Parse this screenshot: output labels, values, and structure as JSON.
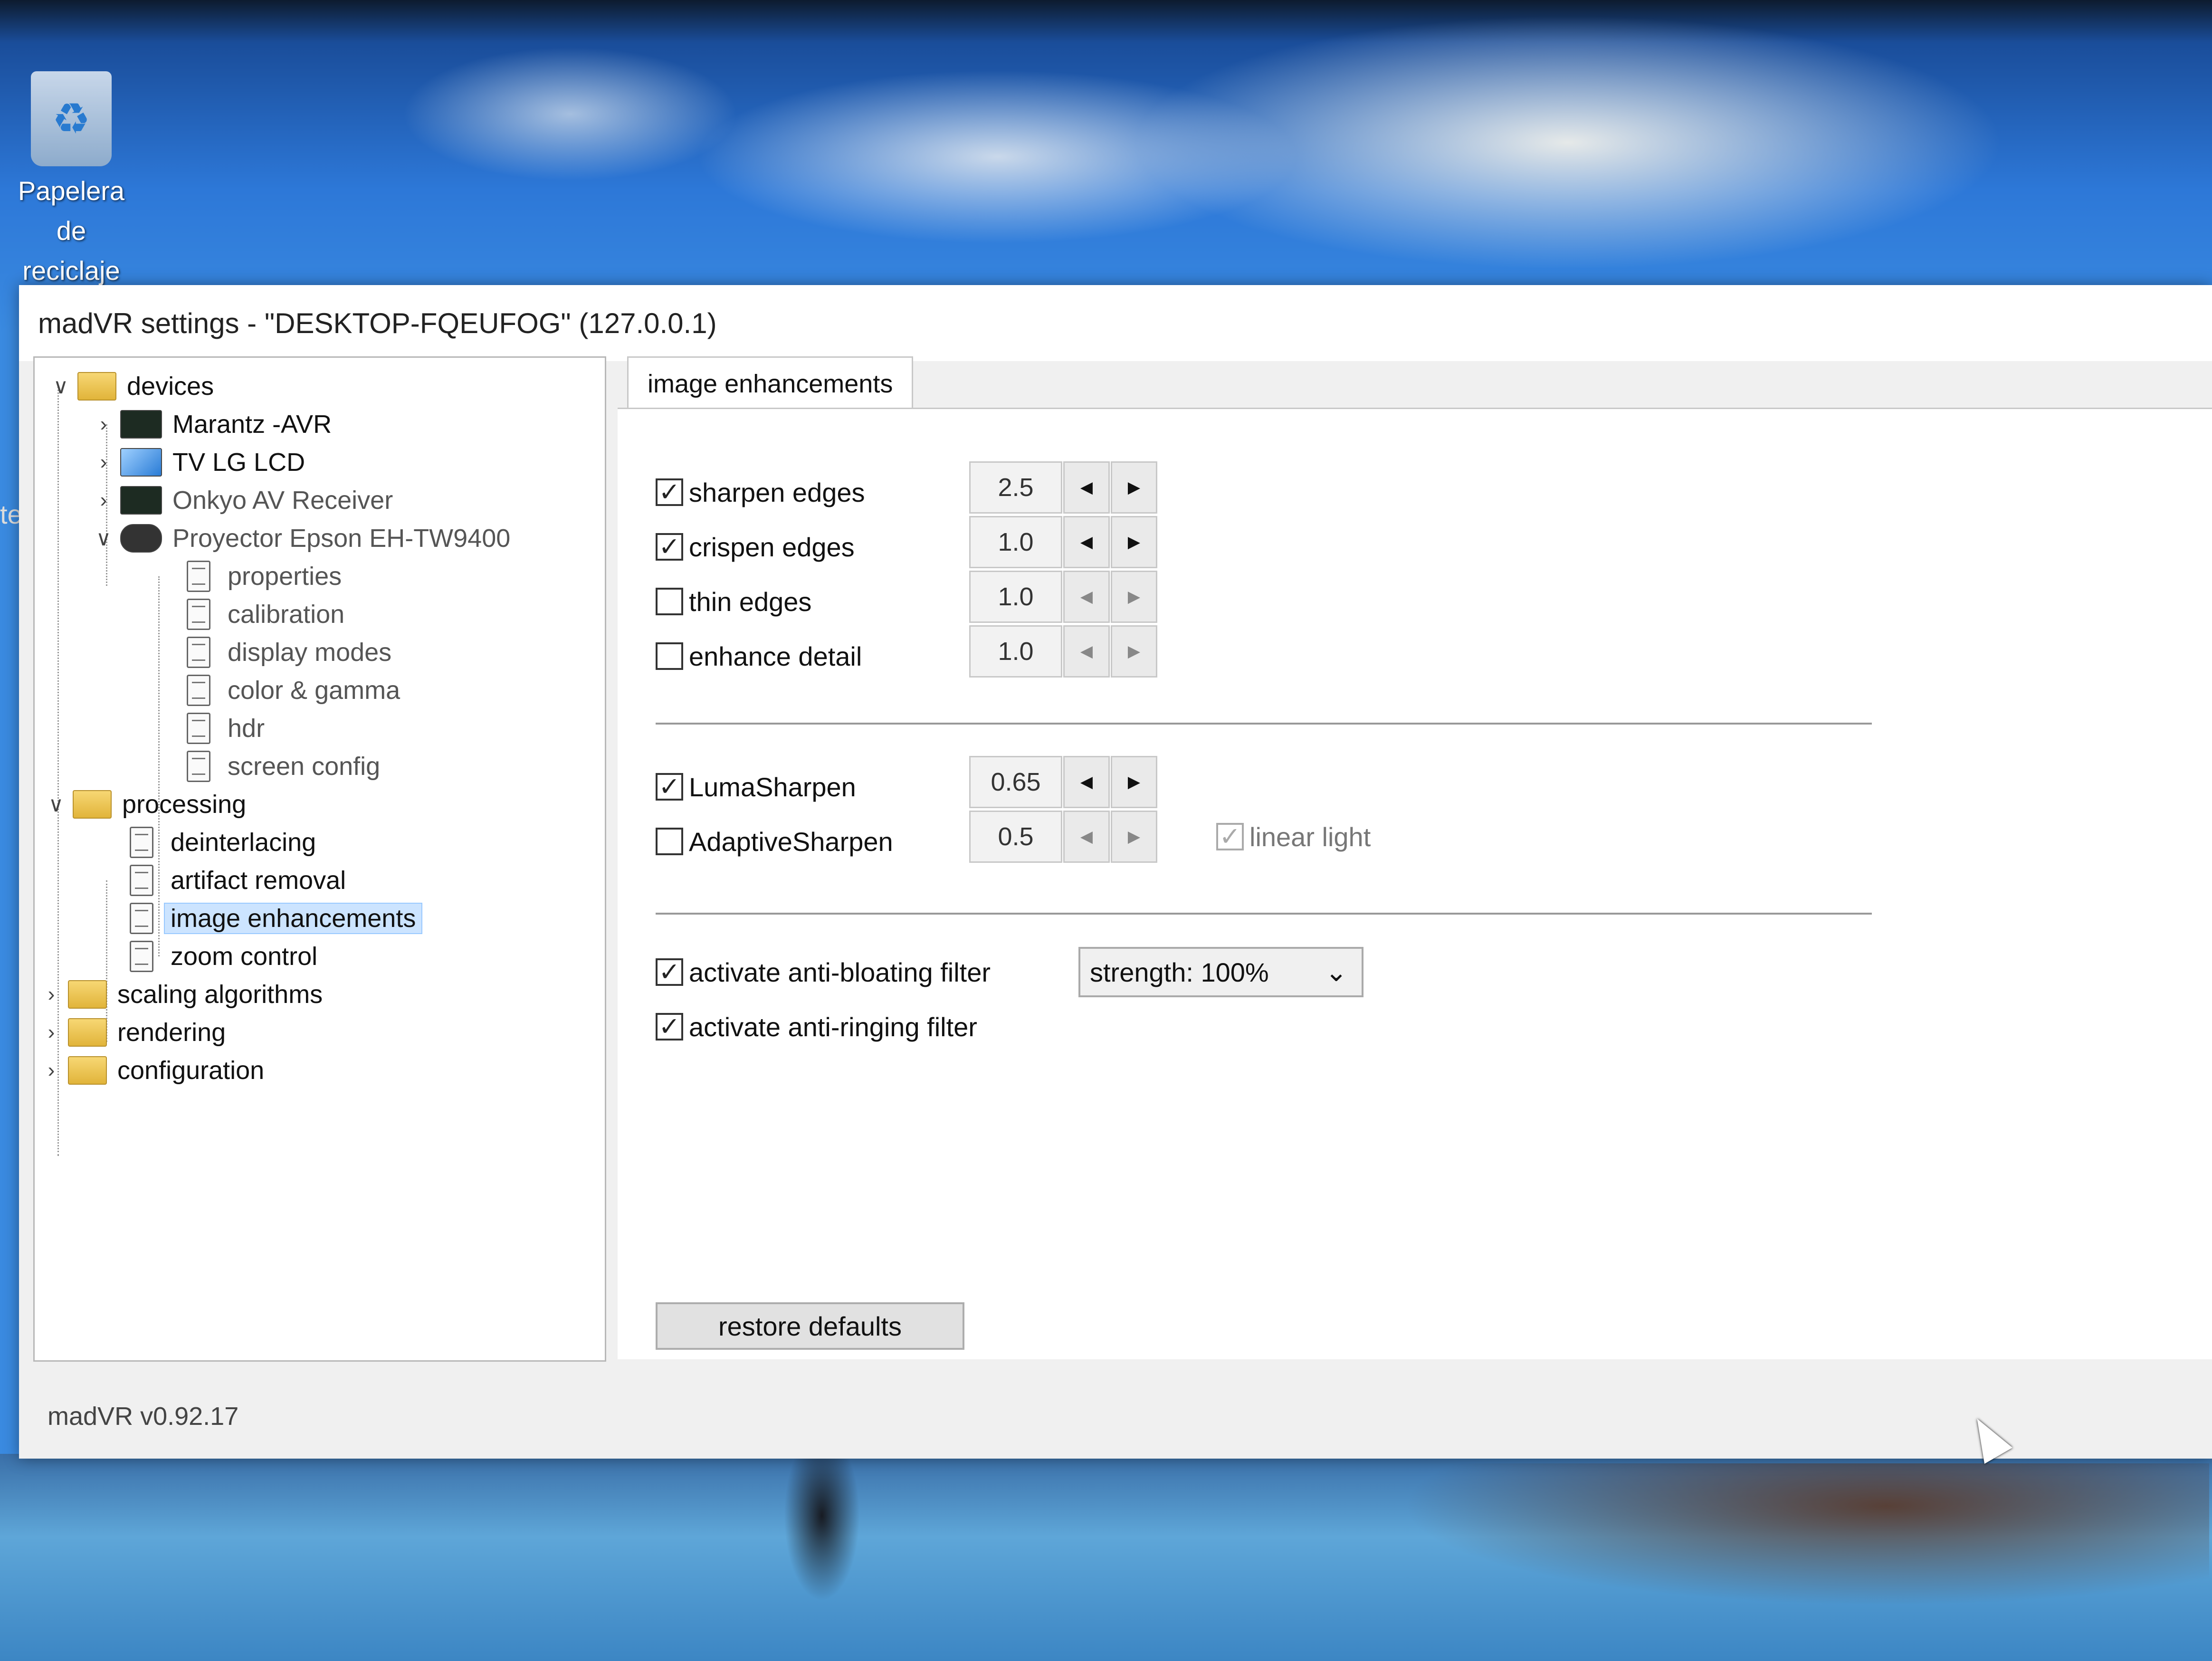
{
  "desktop": {
    "recycle_bin_label_line1": "Papelera de",
    "recycle_bin_label_line2": "reciclaje",
    "left_edge_fragment": "te"
  },
  "window": {
    "title": "madVR settings - \"DESKTOP-FQEUFOG\" (127.0.0.1)",
    "version": "madVR v0.92.17"
  },
  "tree": {
    "devices": "devices",
    "marantz": "Marantz -AVR",
    "tv": "TV LG LCD",
    "onkyo": "Onkyo AV Receiver",
    "projector": "Proyector Epson EH-TW9400",
    "properties": "properties",
    "calibration": "calibration",
    "display_modes": "display modes",
    "color_gamma": "color & gamma",
    "hdr": "hdr",
    "screen_config": "screen config",
    "processing": "processing",
    "deinterlacing": "deinterlacing",
    "artifact_removal": "artifact removal",
    "image_enhancements": "image enhancements",
    "zoom_control": "zoom control",
    "scaling_algorithms": "scaling algorithms",
    "rendering": "rendering",
    "configuration": "configuration"
  },
  "panel": {
    "tab_label": "image enhancements",
    "sharpen_edges": {
      "label": "sharpen edges",
      "checked": true,
      "value": "2.5"
    },
    "crispen_edges": {
      "label": "crispen edges",
      "checked": true,
      "value": "1.0"
    },
    "thin_edges": {
      "label": "thin edges",
      "checked": false,
      "value": "1.0"
    },
    "enhance_detail": {
      "label": "enhance detail",
      "checked": false,
      "value": "1.0"
    },
    "lumasharpen": {
      "label": "LumaSharpen",
      "checked": true,
      "value": "0.65"
    },
    "adaptivesharpen": {
      "label": "AdaptiveSharpen",
      "checked": false,
      "value": "0.5"
    },
    "linear_light": {
      "label": "linear light",
      "checked": true,
      "enabled": false
    },
    "anti_bloating": {
      "label": "activate anti-bloating filter",
      "checked": true
    },
    "strength_select": "strength: 100%",
    "anti_ringing": {
      "label": "activate anti-ringing filter",
      "checked": true
    },
    "restore_defaults": "restore defaults"
  },
  "glyphs": {
    "check": "✓",
    "left": "◀",
    "right": "▶",
    "chev_down": "⌄",
    "chev_right": "›",
    "tree_open": "∨",
    "recycle": "♻"
  }
}
